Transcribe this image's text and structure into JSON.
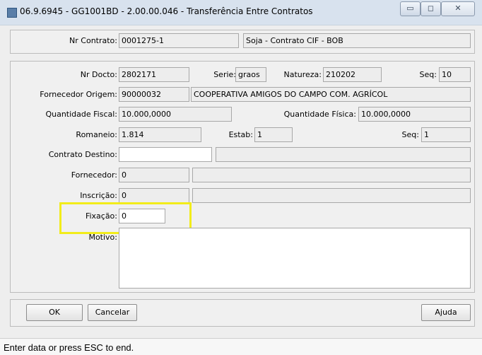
{
  "window": {
    "title": "06.9.6945 - GG1001BD - 2.00.00.046 - Transferência Entre Contratos",
    "minimize_glyph": "▭",
    "maximize_glyph": "◻",
    "close_glyph": "✕"
  },
  "header": {
    "nr_contrato_label": "Nr Contrato:",
    "nr_contrato_value": "0001275-1",
    "contrato_desc_value": "Soja - Contrato CIF - BOB"
  },
  "form": {
    "nr_docto_label": "Nr Docto:",
    "nr_docto_value": "2802171",
    "serie_label": "Serie:",
    "serie_value": "graos",
    "natureza_label": "Natureza:",
    "natureza_value": "210202",
    "seq1_label": "Seq:",
    "seq1_value": "10",
    "fornecedor_origem_label": "Fornecedor Origem:",
    "fornecedor_origem_code": "90000032",
    "fornecedor_origem_name": "COOPERATIVA AMIGOS DO CAMPO COM. AGRÍCOL",
    "qtd_fiscal_label": "Quantidade Fiscal:",
    "qtd_fiscal_value": "10.000,0000",
    "qtd_fisica_label": "Quantidade Física:",
    "qtd_fisica_value": "10.000,0000",
    "romaneio_label": "Romaneio:",
    "romaneio_value": "1.814",
    "estab_label": "Estab:",
    "estab_value": "1",
    "seq2_label": "Seq:",
    "seq2_value": "1",
    "contrato_destino_label": "Contrato Destino:",
    "contrato_destino_value": "",
    "contrato_destino_desc": "",
    "fornecedor_label": "Fornecedor:",
    "fornecedor_value": "0",
    "fornecedor_desc": "",
    "inscricao_label": "Inscrição:",
    "inscricao_value": "0",
    "inscricao_desc": "",
    "fixacao_label": "Fixação:",
    "fixacao_value": "0",
    "motivo_label": "Motivo:",
    "motivo_value": ""
  },
  "buttons": {
    "ok": "OK",
    "cancelar": "Cancelar",
    "ajuda": "Ajuda"
  },
  "status": {
    "text": "Enter data or press ESC to end."
  },
  "colors": {
    "highlight": "#f2ec1a"
  }
}
